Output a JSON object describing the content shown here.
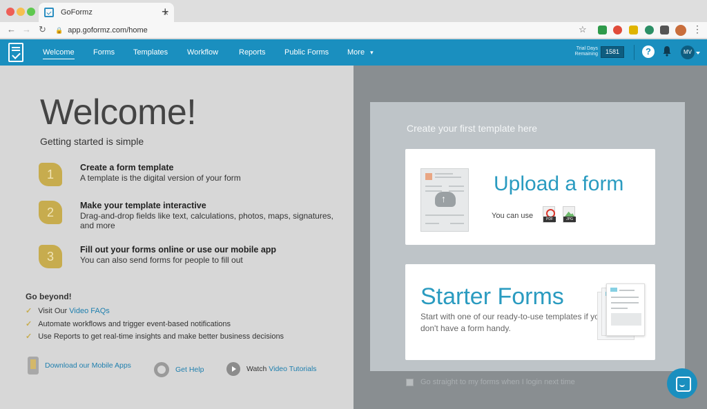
{
  "browser": {
    "tab_title": "GoFormz",
    "tab_close": "×",
    "new_tab": "+",
    "url": "app.goformz.com/home",
    "back": "←",
    "forward": "→",
    "reload": "↻",
    "lock": "🔒",
    "star": "☆",
    "menu": "⋮"
  },
  "nav": {
    "items": [
      "Welcome",
      "Forms",
      "Templates",
      "Workflow",
      "Reports",
      "Public Forms",
      "More"
    ],
    "more_caret": "▾",
    "trial_label_1": "Trial Days",
    "trial_label_2": "Remaining",
    "trial_days": "1581",
    "help": "?",
    "avatar_initials": "MV"
  },
  "welcome": {
    "title": "Welcome!",
    "subtitle": "Getting started is simple",
    "steps": [
      {
        "number": "1",
        "title": "Create a form template",
        "desc": "A template is the digital version of your form"
      },
      {
        "number": "2",
        "title": "Make your template interactive",
        "desc": "Drag-and-drop fields like text, calculations, photos, maps, signatures, and more"
      },
      {
        "number": "3",
        "title": "Fill out your forms online or use our mobile app",
        "desc": "You can also send forms for people to fill out"
      }
    ],
    "go_beyond": "Go beyond!",
    "checks": [
      {
        "prefix": "Visit Our ",
        "link": "Video FAQs"
      },
      {
        "prefix": "Automate workflows and trigger event-based notifications",
        "link": ""
      },
      {
        "prefix": "Use Reports to get real-time insights and make better business decisions",
        "link": ""
      }
    ],
    "check_mark": "✓",
    "footer": {
      "mobile_apps": "Download our Mobile Apps",
      "get_help": "Get Help",
      "watch_prefix": "Watch ",
      "video_tutorials": "Video Tutorials"
    }
  },
  "right_panel": {
    "create_title": "Create your first template here",
    "upload": {
      "title": "Upload a form",
      "note": "You can use",
      "pdf_label": "PDF",
      "jpg_label": "JPG"
    },
    "starter": {
      "title": "Starter Forms",
      "desc": "Start with one of our ready-to-use templates if you don't have a form handy."
    },
    "keep_label": "Go straight to my forms when I login next time"
  },
  "colors": {
    "brand": "#1a8fbf",
    "step_badge": "#c7ac4e",
    "link": "#1e7fae",
    "headline": "#2a9bc0"
  }
}
